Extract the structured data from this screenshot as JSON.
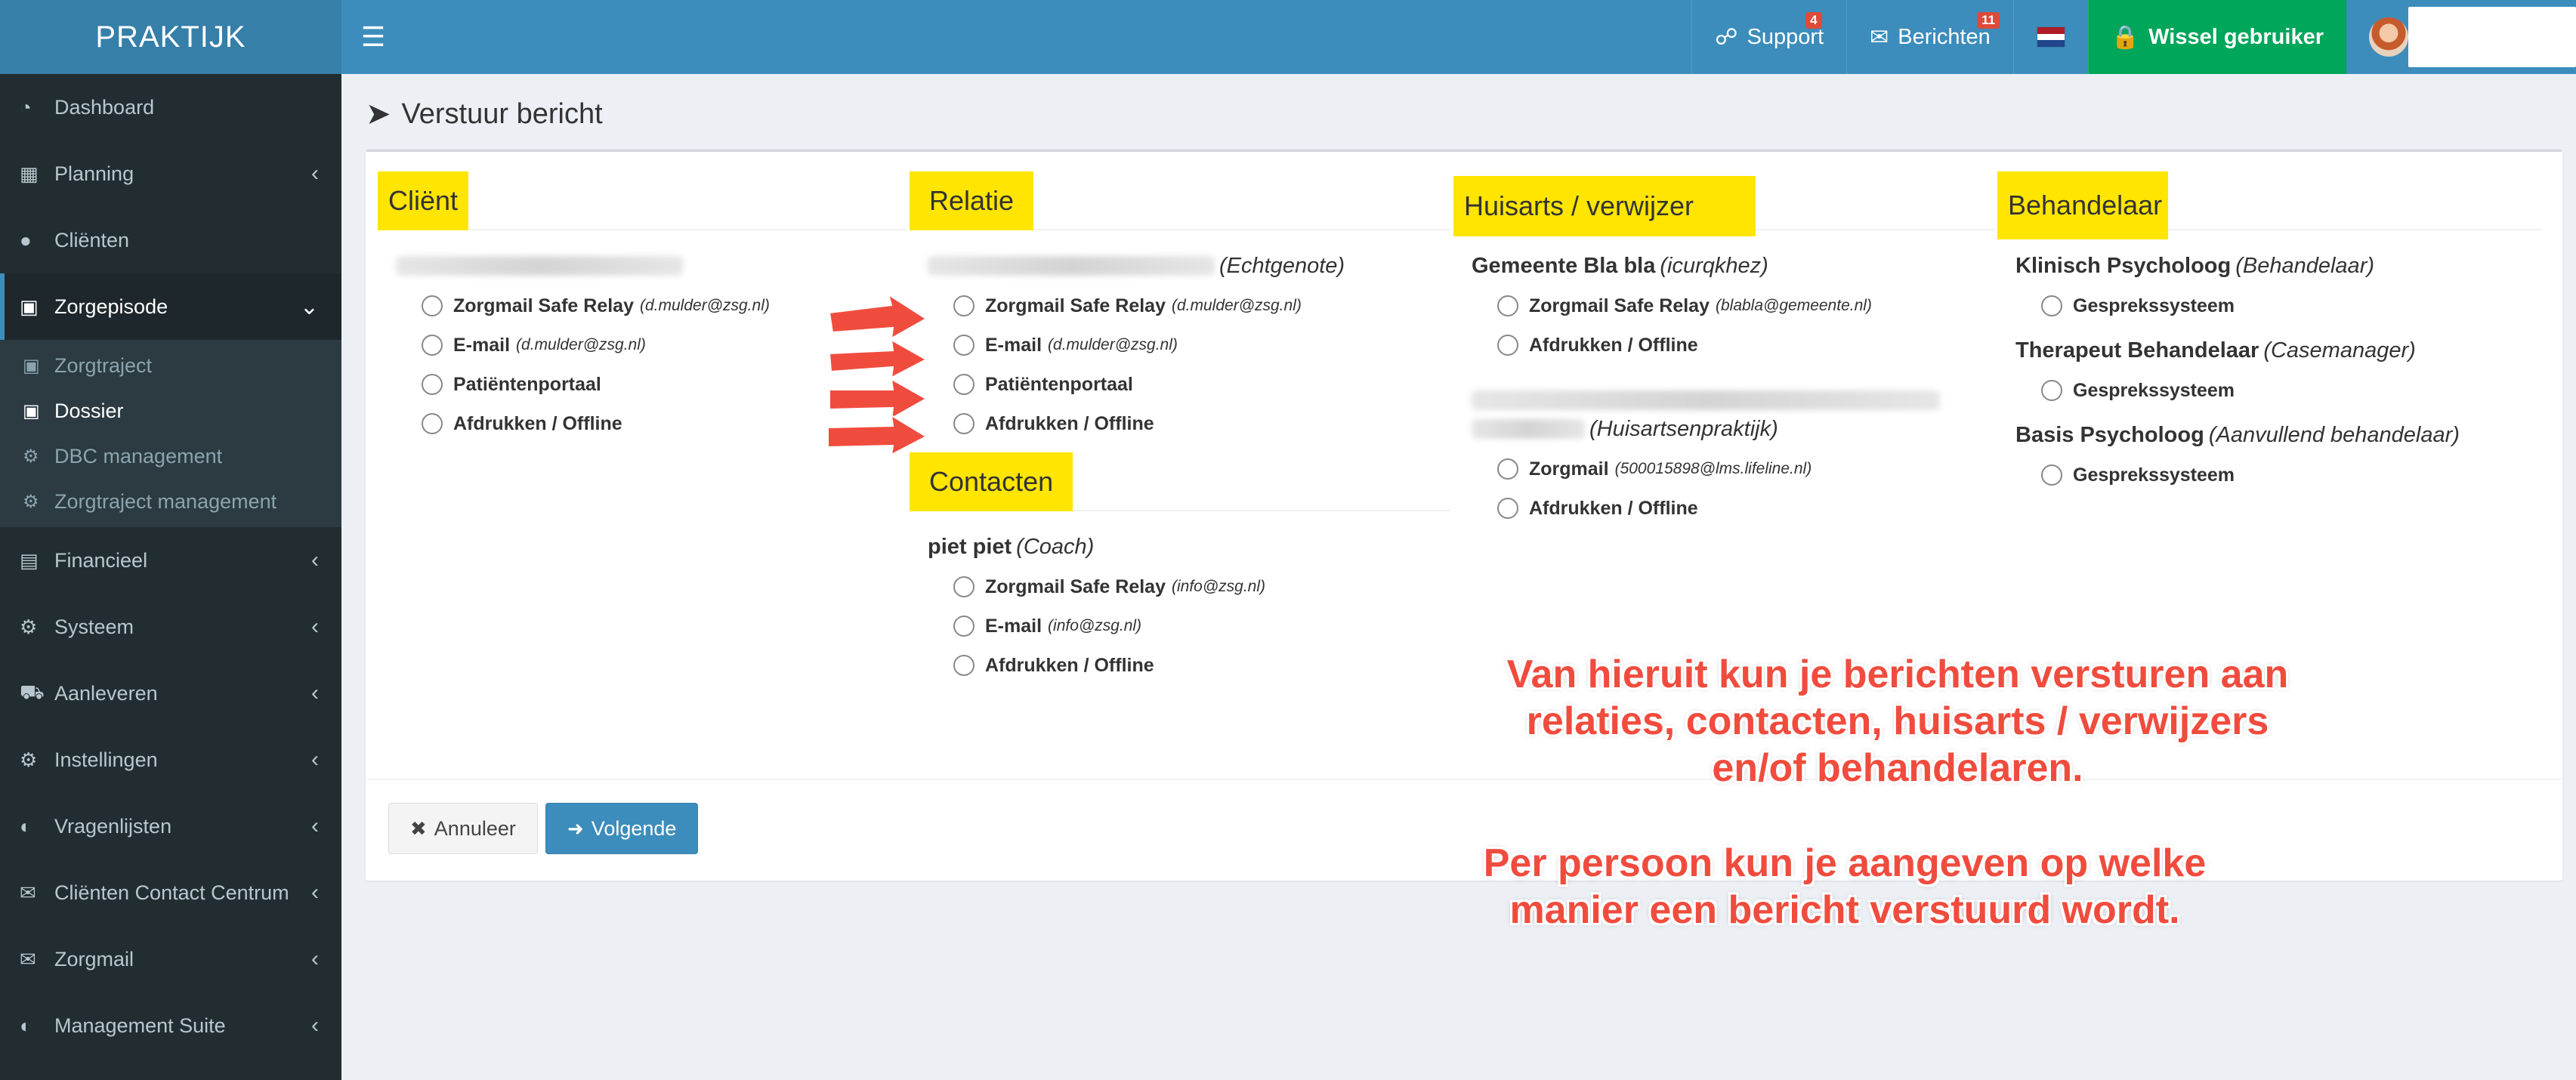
{
  "app": {
    "logo": "PRAKTIJK"
  },
  "navbar": {
    "support_label": "Support",
    "support_badge": "4",
    "messages_label": "Berichten",
    "messages_badge": "11",
    "switch_user_label": "Wissel gebruiker",
    "flag_colors": [
      "#ae1c28",
      "#ffffff",
      "#21468b"
    ]
  },
  "sidebar": {
    "items": [
      {
        "label": "Dashboard",
        "icon": "dashboard-icon"
      },
      {
        "label": "Planning",
        "icon": "calendar-icon"
      },
      {
        "label": "Cliënten",
        "icon": "user-icon"
      },
      {
        "label": "Zorgepisode",
        "icon": "briefcase-icon"
      },
      {
        "label": "Financieel",
        "icon": "book-icon"
      },
      {
        "label": "Systeem",
        "icon": "cogs-icon"
      },
      {
        "label": "Aanleveren",
        "icon": "truck-icon"
      },
      {
        "label": "Instellingen",
        "icon": "gear-icon"
      },
      {
        "label": "Vragenlijsten",
        "icon": "globe-icon"
      },
      {
        "label": "Cliënten Contact Centrum",
        "icon": "envelope-icon"
      },
      {
        "label": "Zorgmail",
        "icon": "envelope-icon"
      },
      {
        "label": "Management Suite",
        "icon": "globe-icon"
      }
    ],
    "submenu": [
      {
        "label": "Zorgtraject"
      },
      {
        "label": "Dossier"
      },
      {
        "label": "DBC management"
      },
      {
        "label": "Zorgtraject management"
      }
    ]
  },
  "page": {
    "title": "Verstuur bericht"
  },
  "columns": {
    "client": {
      "title": "Cliënt",
      "options": [
        {
          "label": "Zorgmail Safe Relay",
          "addr": "(d.mulder@zsg.nl)"
        },
        {
          "label": "E-mail",
          "addr": "(d.mulder@zsg.nl)"
        },
        {
          "label": "Patiëntenportaal",
          "addr": ""
        },
        {
          "label": "Afdrukken / Offline",
          "addr": ""
        }
      ]
    },
    "relatie": {
      "title": "Relatie",
      "person_role": "(Echtgenote)",
      "options": [
        {
          "label": "Zorgmail Safe Relay",
          "addr": "(d.mulder@zsg.nl)"
        },
        {
          "label": "E-mail",
          "addr": "(d.mulder@zsg.nl)"
        },
        {
          "label": "Patiëntenportaal",
          "addr": ""
        },
        {
          "label": "Afdrukken / Offline",
          "addr": ""
        }
      ]
    },
    "contacten": {
      "title": "Contacten",
      "person_name": "piet piet",
      "person_role": "(Coach)",
      "options": [
        {
          "label": "Zorgmail Safe Relay",
          "addr": "(info@zsg.nl)"
        },
        {
          "label": "E-mail",
          "addr": "(info@zsg.nl)"
        },
        {
          "label": "Afdrukken / Offline",
          "addr": ""
        }
      ]
    },
    "huisarts": {
      "title": "Huisarts / verwijzer",
      "person1_name": "Gemeente Bla bla",
      "person1_role": "(icurqkhez)",
      "person1_options": [
        {
          "label": "Zorgmail Safe Relay",
          "addr": "(blabla@gemeente.nl)"
        },
        {
          "label": "Afdrukken / Offline",
          "addr": ""
        }
      ],
      "person2_role": "(Huisartsenpraktijk)",
      "person2_options": [
        {
          "label": "Zorgmail",
          "addr": "(500015898@lms.lifeline.nl)"
        },
        {
          "label": "Afdrukken / Offline",
          "addr": ""
        }
      ]
    },
    "behandelaar": {
      "title": "Behandelaar",
      "people": [
        {
          "name": "Klinisch Psycholoog",
          "role": "(Behandelaar)",
          "option": "Gesprekssysteem"
        },
        {
          "name": "Therapeut Behandelaar",
          "role": "(Casemanager)",
          "option": "Gesprekssysteem"
        },
        {
          "name": "Basis Psycholoog",
          "role": "(Aanvullend behandelaar)",
          "option": "Gesprekssysteem"
        }
      ]
    }
  },
  "footer": {
    "cancel_label": "Annuleer",
    "next_label": "Volgende"
  },
  "annotation": {
    "line1": "Van hieruit kun je berichten versturen aan",
    "line2": "relaties, contacten, huisarts / verwijzers",
    "line3": "en/of behandelaren.",
    "line4": "Per persoon kun je aangeven op welke",
    "line5": "manier een bericht verstuurd wordt.",
    "color": "#f04c3e"
  }
}
